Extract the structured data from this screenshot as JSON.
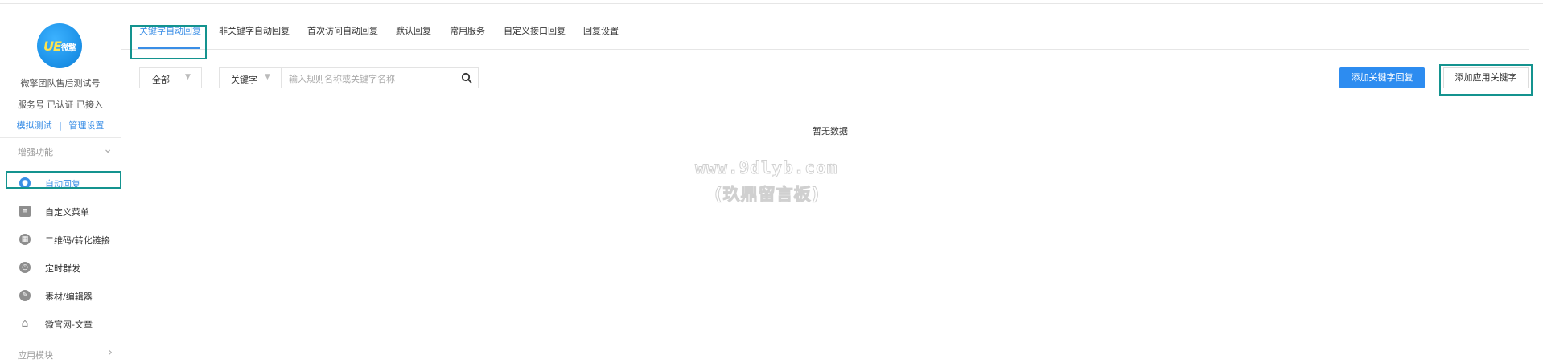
{
  "account": {
    "logo_text": "UE",
    "logo_subtext": "微擎",
    "name": "微擎团队售后测试号",
    "status": "服务号 已认证 已接入",
    "links": [
      "模拟测试",
      "管理设置"
    ],
    "link_separator": "|"
  },
  "sidebar": {
    "section_enhanced": "增强功能",
    "items": [
      {
        "label": "自动回复",
        "icon": "chat-bubble-icon",
        "active": true
      },
      {
        "label": "自定义菜单",
        "icon": "menu-doc-icon",
        "active": false
      },
      {
        "label": "二维码/转化链接",
        "icon": "qrcode-icon",
        "active": false
      },
      {
        "label": "定时群发",
        "icon": "clock-icon",
        "active": false
      },
      {
        "label": "素材/编辑器",
        "icon": "pencil-icon",
        "active": false
      },
      {
        "label": "微官网-文章",
        "icon": "home-icon",
        "active": false
      }
    ],
    "section_modules": "应用模块"
  },
  "tabs": [
    {
      "label": "关键字自动回复",
      "active": true
    },
    {
      "label": "非关键字自动回复",
      "active": false
    },
    {
      "label": "首次访问自动回复",
      "active": false
    },
    {
      "label": "默认回复",
      "active": false
    },
    {
      "label": "常用服务",
      "active": false
    },
    {
      "label": "自定义接口回复",
      "active": false
    },
    {
      "label": "回复设置",
      "active": false
    }
  ],
  "filter": {
    "status_select": "全部",
    "search_type": "关键字",
    "search_placeholder": "输入规则名称或关键字名称",
    "search_value": ""
  },
  "actions": {
    "add_keyword_reply": "添加关键字回复",
    "add_app_keyword": "添加应用关键字"
  },
  "empty_text": "暂无数据",
  "watermark": {
    "line1": "www.9dlyb.com",
    "line2": "(玖鼎留言板)"
  },
  "colors": {
    "accent": "#2d8cf0",
    "highlight": "#14938f"
  }
}
